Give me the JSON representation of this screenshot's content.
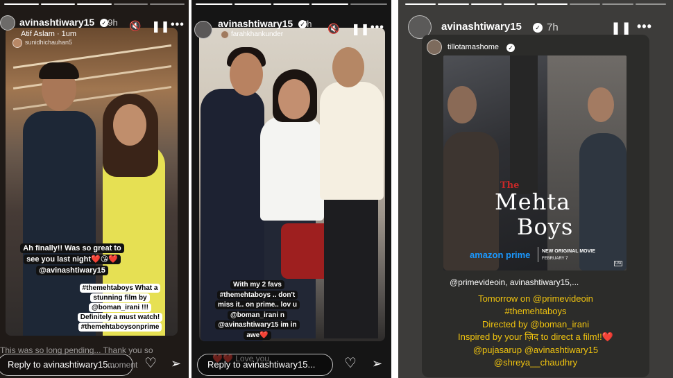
{
  "story1": {
    "username": "avinashtiwary15",
    "time": "19h",
    "music": "Atif Aslam · 1um",
    "reshare_user": "sunidhichauhan5",
    "sticker_main": [
      "Ah finally!! Was so great to",
      "see you last night❤️😘❤️",
      "@avinashtiwary15"
    ],
    "sticker_hashtag": [
      "#themehtaboys What a",
      "stunning film by",
      "@boman_irani !!!",
      "Definitely a must watch!",
      "#themehtaboysonprime"
    ],
    "caption_peek": "This was so long pending... Thank you so",
    "reply_placeholder": "Reply to avinashtiwary15...",
    "moment_peek": "moment"
  },
  "story2": {
    "username": "avinashtiwary15",
    "time": "7h",
    "reshare_user": "farahkhankunder",
    "sticker": [
      "With my 2 favs",
      "#themehtaboys .. don't",
      "miss it.. on prime.. lov u",
      "@boman_irani n",
      "@avinashtiwary15 im in",
      "awe❤️"
    ],
    "love_peek": "❤️❤️ Love you",
    "reply_placeholder": "Reply to avinashtiwary15..."
  },
  "story3": {
    "username": "avinashtiwary15",
    "time": "7h",
    "reshare_user": "tillotamashome",
    "poster": {
      "title_small": "The",
      "title_line1": "Mehta",
      "title_line2": "Boys",
      "brand": "amazon prime",
      "tagline": "NEW ORIGINAL MOVIE",
      "date": "FEBRUARY 7",
      "rating": "U/A"
    },
    "mentions": "@primevideoin, avinashtiwary15,...",
    "caption": [
      "Tomorrow on @primevideoin",
      "#themehtaboys",
      "Directed by @boman_irani",
      "Inspired by your ज़िद to direct a film!!❤️",
      "@pujasarup @avinashtiwary15",
      "@shreya__chaudhry"
    ]
  },
  "colors": {
    "caption_yellow": "#f1c40f",
    "prime_blue": "#1a98ff"
  },
  "icons": [
    "mute-icon",
    "pause-icon",
    "more-icon",
    "heart-icon",
    "send-icon",
    "verified-icon"
  ]
}
